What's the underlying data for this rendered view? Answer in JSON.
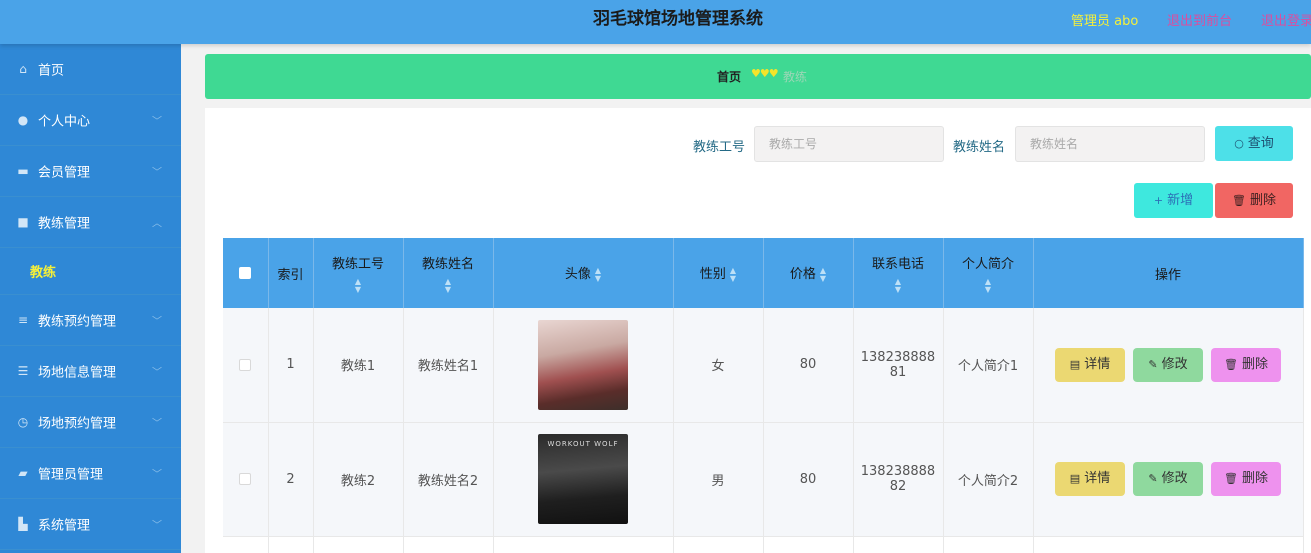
{
  "header": {
    "title": "羽毛球馆场地管理系统",
    "admin": "管理员 abo",
    "link_front": "退出到前台",
    "link_logout": "退出登录"
  },
  "sidebar": {
    "items": [
      {
        "label": "首页",
        "icon": "home-icon"
      },
      {
        "label": "个人中心",
        "icon": "user-icon"
      },
      {
        "label": "会员管理",
        "icon": "member-icon"
      },
      {
        "label": "教练管理",
        "icon": "briefcase-icon"
      },
      {
        "label": "教练预约管理",
        "icon": "list-icon"
      },
      {
        "label": "场地信息管理",
        "icon": "sliders-icon"
      },
      {
        "label": "场地预约管理",
        "icon": "clock-icon"
      },
      {
        "label": "管理员管理",
        "icon": "admin-icon"
      },
      {
        "label": "系统管理",
        "icon": "system-icon"
      }
    ],
    "submenu": "教练"
  },
  "breadcrumb": {
    "home": "首页",
    "current": "教练"
  },
  "search": {
    "label_id": "教练工号",
    "placeholder_id": "教练工号",
    "label_name": "教练姓名",
    "placeholder_name": "教练姓名",
    "search_btn": "查询"
  },
  "toolbar": {
    "add": "新增",
    "delete": "删除"
  },
  "table": {
    "headers": [
      "索引",
      "教练工号",
      "教练姓名",
      "头像",
      "性别",
      "价格",
      "联系电话",
      "个人简介",
      "操作"
    ],
    "rows": [
      {
        "index": "1",
        "id": "教练1",
        "name": "教练姓名1",
        "gender": "女",
        "price": "80",
        "phone1": "138238888",
        "phone2": "81",
        "intro": "个人简介1"
      },
      {
        "index": "2",
        "id": "教练2",
        "name": "教练姓名2",
        "gender": "男",
        "price": "80",
        "phone1": "138238888",
        "phone2": "82",
        "intro": "个人简介2"
      }
    ],
    "actions": {
      "detail": "详情",
      "edit": "修改",
      "delete": "删除"
    },
    "avatar2_text": "WORKOUT WOLF"
  }
}
